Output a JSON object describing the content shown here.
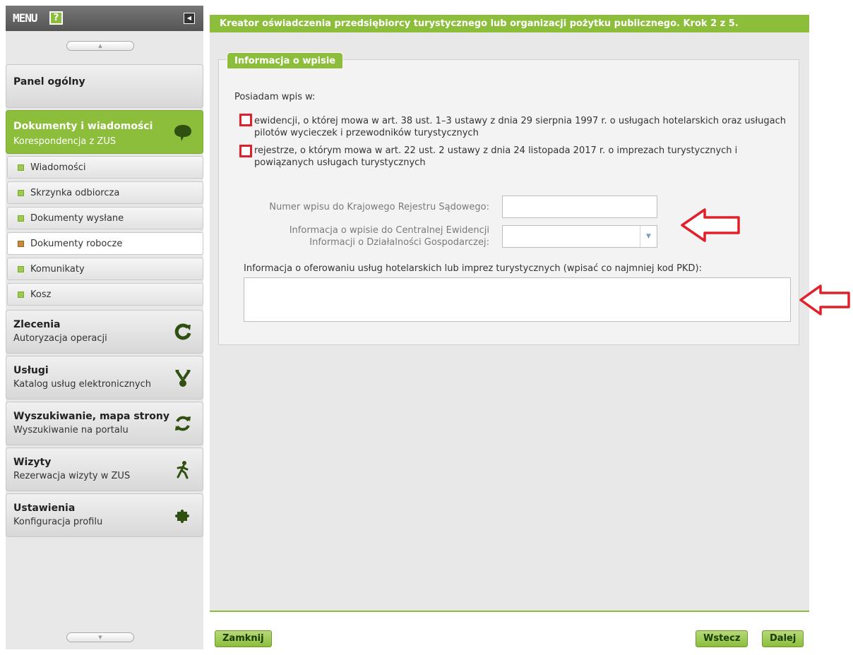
{
  "sidebar": {
    "menu_title": "MENU",
    "help_label": "?",
    "panel_general": "Panel ogólny",
    "active_title": "Dokumenty i wiadomości",
    "active_sub": "Korespondencja z ZUS",
    "sub_items": [
      "Wiadomości",
      "Skrzynka odbiorcza",
      "Dokumenty wysłane",
      "Dokumenty robocze",
      "Komunikaty",
      "Kosz"
    ],
    "sections": [
      {
        "title": "Zlecenia",
        "sub": "Autoryzacja operacji",
        "icon": "refresh-icon"
      },
      {
        "title": "Usługi",
        "sub": "Katalog usług elektronicznych",
        "icon": "services-icon"
      },
      {
        "title": "Wyszukiwanie, mapa strony",
        "sub": "Wyszukiwanie na portalu",
        "icon": "sync-icon"
      },
      {
        "title": "Wizyty",
        "sub": "Rezerwacja wizyty w ZUS",
        "icon": "walking-person-icon"
      },
      {
        "title": "Ustawienia",
        "sub": "Konfiguracja profilu",
        "icon": "puzzle-icon"
      }
    ]
  },
  "main": {
    "header": "Kreator oświadczenia przedsiębiorcy turystycznego lub organizacji pożytku publicznego. Krok 2 z 5.",
    "section_tab": "Informacja o wpisie",
    "intro": "Posiadam wpis w:",
    "option1_line1": "ewidencji, o której mowa w art. 38 ust. 1–3 ustawy z dnia 29 sierpnia 1997 r. o usługach hotelarskich oraz usługach",
    "option1_line2": "pilotów wycieczek i przewodników turystycznych",
    "option2_line1": "rejestrze, o którym mowa w art. 22 ust. 2 ustawy z dnia 24 listopada 2017 r. o imprezach turystycznych i",
    "option2_line2": "powiązanych usługach turystycznych",
    "krs_label": "Numer wpisu do Krajowego Rejestru Sądowego:",
    "ceidg_label_line1": "Informacja o wpisie do Centralnej Ewidencji",
    "ceidg_label_line2": "Informacji o Działalności Gospodarczej:",
    "pkd_label": "Informacja o oferowaniu usług hotelarskich lub imprez turystycznych (wpisać co najmniej kod PKD):"
  },
  "buttons": {
    "close": "Zamknij",
    "back": "Wstecz",
    "next": "Dalej"
  },
  "colors": {
    "accent_green": "#8cbe3c",
    "highlight_red": "#e0202a"
  }
}
